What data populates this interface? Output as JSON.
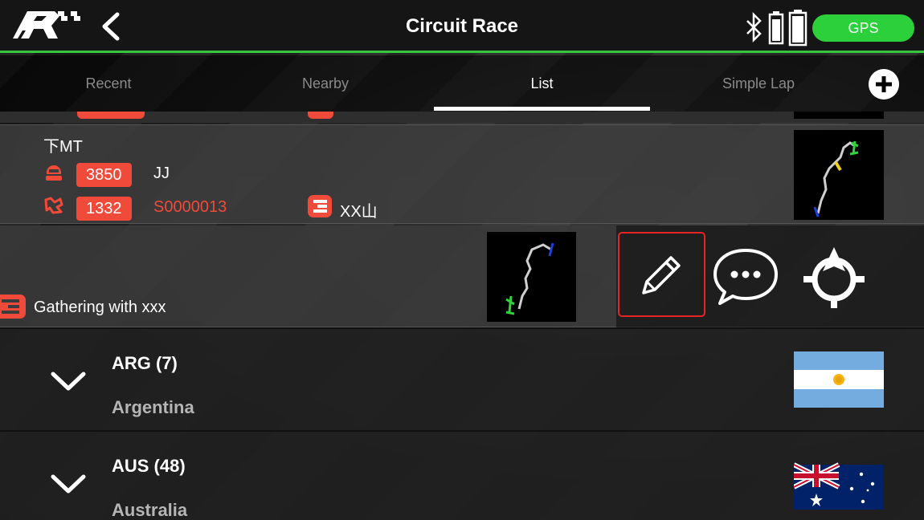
{
  "header": {
    "title": "Circuit Race",
    "gps_label": "GPS"
  },
  "tabs": [
    {
      "label": "Recent",
      "active": false
    },
    {
      "label": "Nearby",
      "active": false
    },
    {
      "label": "List",
      "active": true
    },
    {
      "label": "Simple Lap",
      "active": false
    }
  ],
  "tracks": [
    {
      "name": "下MT",
      "owner_count": "3850",
      "owner": "JJ",
      "track_length": "1332",
      "track_id": "S0000013",
      "location": "XX山"
    },
    {
      "name": "Gathering with xxx",
      "swiped": true,
      "actions": [
        "edit-icon",
        "comment-icon",
        "locate-icon"
      ]
    }
  ],
  "countries": [
    {
      "code": "ARG (7)",
      "name": "Argentina",
      "flag": "argentina"
    },
    {
      "code": "AUS (48)",
      "name": "Australia",
      "flag": "australia"
    }
  ],
  "colors": {
    "accent": "#39c53b",
    "badge": "#f04a3a",
    "gps": "#2cd03a",
    "highlight": "#e32525"
  }
}
